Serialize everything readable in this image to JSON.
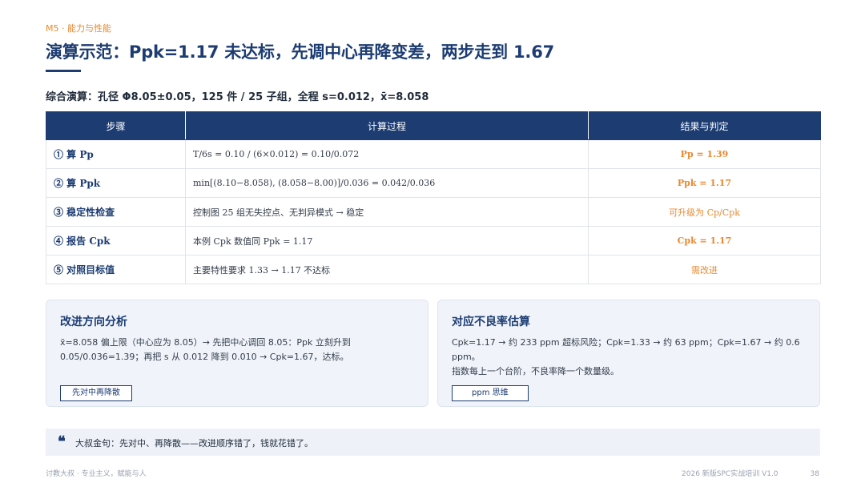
{
  "header": {
    "section_tag": "M5 · 能力与性能",
    "title": "演算示范：Ppk=1.17 未达标，先调中心再降变差，两步走到 1.67",
    "subtitle": "综合演算：孔径 Φ8.05±0.05，125 件 / 25 子组，全程 s=0.012，x̄=8.058"
  },
  "table": {
    "headers": [
      "步骤",
      "计算过程",
      "结果与判定"
    ],
    "rows": [
      {
        "step": "① 算 Pp",
        "calc": "T/6s = 0.10 / (6×0.012) = 0.10/0.072",
        "result": "Pp = 1.39"
      },
      {
        "step": "② 算 Ppk",
        "calc": "min[(8.10−8.058), (8.058−8.00)]/0.036 = 0.042/0.036",
        "result": "Ppk = 1.17"
      },
      {
        "step": "③ 稳定性检查",
        "calc": "控制图 25 组无失控点、无判异模式 → 稳定",
        "result": "可升级为 Cp/Cpk"
      },
      {
        "step": "④ 报告 Cpk",
        "calc": "本例 Cpk 数值同 Ppk = 1.17",
        "result": "Cpk = 1.17"
      },
      {
        "step": "⑤ 对照目标值",
        "calc": "主要特性要求 1.33 → 1.17 不达标",
        "result": "需改进"
      }
    ]
  },
  "cards": [
    {
      "title": "改进方向分析",
      "body_line1": "x̄=8.058 偏上限（中心应为 8.05）→ 先把中心调回 8.05：Ppk 立刻升到",
      "body_line2": "0.05/0.036=1.39；再把 s 从 0.012 降到 0.010 → Cpk=1.67，达标。",
      "tag": "先对中再降散"
    },
    {
      "title": "对应不良率估算",
      "body_line1": "Cpk=1.17 → 约 233 ppm 超标风险；Cpk=1.33 → 约 63 ppm；Cpk=1.67 → 约 0.6 ppm。",
      "body_line2": "指数每上一个台阶，不良率降一个数量级。",
      "tag": "ppm 思维"
    }
  ],
  "quote": {
    "icon": "quote-icon",
    "text": "大叔金句：先对中、再降散——改进顺序错了，钱就花错了。"
  },
  "footer": {
    "left": "讨教大叔 · 专业主义，赋能与人",
    "right": "2026 新版SPC实战培训 V1.0",
    "page": "38"
  },
  "colors": {
    "primary": "#1c3c72",
    "accent": "#e8892f"
  }
}
